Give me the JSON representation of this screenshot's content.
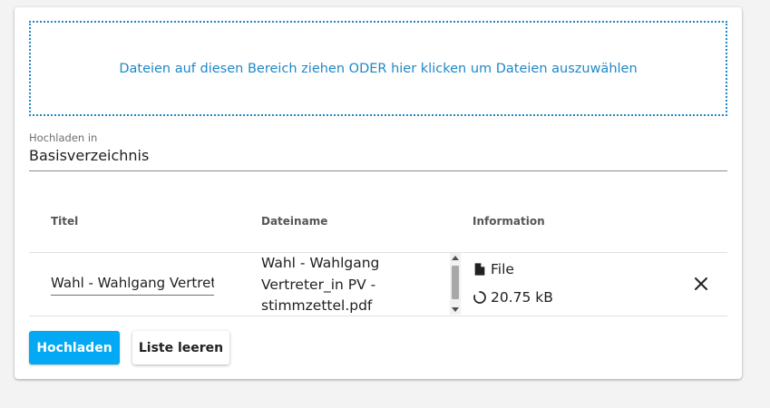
{
  "dropzone": {
    "text": "Dateien auf diesen Bereich ziehen ODER hier klicken um Dateien auszuwählen"
  },
  "upload_target": {
    "label": "Hochladen in",
    "value": "Basisverzeichnis"
  },
  "table": {
    "headers": [
      "Titel",
      "Dateiname",
      "Information"
    ],
    "rows": [
      {
        "title": "Wahl - Wahlgang Vertreter_in PV - stimmzettel",
        "title_visible": "Wahl - Wahlgang Vertrete",
        "filename": "Wahl - Wahlgang Vertreter_in PV - stimmzettel.pdf",
        "filename_lines": [
          "Wahl - Wahlgang",
          "Vertreter_in PV -",
          "stimmzettel.pdf"
        ],
        "type": "File",
        "size": "20.75 kB",
        "type_icon": "file-icon",
        "size_icon": "spinner-icon",
        "remove_icon": "close-icon"
      }
    ]
  },
  "actions": {
    "upload_label": "Hochladen",
    "clear_label": "Liste leeren"
  },
  "colors": {
    "accent": "#1e88c8",
    "primary_button": "#03a9f4"
  }
}
